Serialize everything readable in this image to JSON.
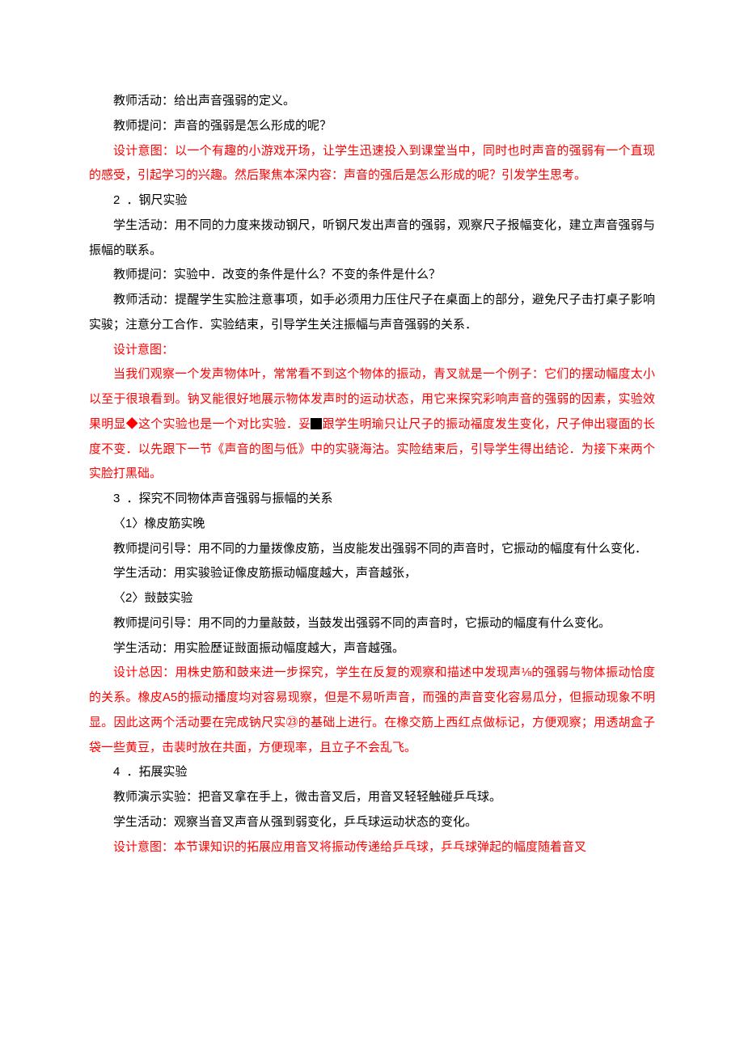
{
  "p1": "教师活动：给出声音强弱的定义。",
  "p2": "教师提问：声音的强弱是怎么形成的呢？",
  "p3": "设计意图：以一个有趣的小游戏开场，让学生迅速投入到课堂当中，同时也时声音的强弱有一个直现的感受，引起学习的兴趣。然后聚焦本深内容：声音的强后是怎么形成的呢？引发学生思考。",
  "s2_num": "2",
  "s2_title": "．钢尺实验",
  "p4": "学生活动：用不同的力度来拨动钢尺，听钢尺发出声音的强弱，观察尺子报幅变化，建立声音强弱与振幅的联系。",
  "p5": "教师提问：实验中．改变的条件是什么？不变的条件是什么？",
  "p6": "教师活动：提醒学生实脸注意事项，如手必须用力压住尺子在桌面上的部分，避免尺子击打桌子影响实骏；注意分工合作．实验结束，引导学生关注振幅与声音强弱的关系．",
  "p7": "设计意图：",
  "p8a": "当我们观察一个发声物体叶，常常看不到这个物体的振动，青叉就是一个例子：它们的摆动幅度太小以至于很琅看到。钠叉能很好地展示物体发声时的运动状态，用它来探究彩响声音的强弱的因素，实验效果明显◆这个实验也是一个对比实验．妥",
  "p8b": "跟学生明瑜只让尺子的振动福度发生变化，尺子伸出寝面的长度不变．以先跟下一节《声音的图与低》中的实骁海沽。实险结束后，引导学生得出结论．为接下来两个实脸打黑础。",
  "s3_num": "3",
  "s3_title": "．探究不同物体声音强弱与振幅的关系",
  "sub1_paren": "〈1〉",
  "sub1_title": "橡皮筋实晚",
  "p9": "教师提问引导：用不同的力量拨像皮筋，当皮能发出强弱不同的声音时，它振动的幅度有什么变化．",
  "p10": "学生活动：用实骏验证像皮筋振动幅度越大，声音越张，",
  "sub2_paren": "〈2〉",
  "sub2_title": "敱鼓实验",
  "p11": "教师提问引导：用不同的力量敲鼓，当鼓发出强弱不同的声音时，它振动的幅度有什么变化。",
  "p12": "学生活动：用实脸歷证敱面振动幅度越大，声音越强。",
  "p13a": "设计总因：用株史筋和鼓来进一步探究，学生在反复的观察和描述中发现声",
  "p13_frac": "⅛",
  "p13b": "的强弱与物体振动恰度的关系。橡皮",
  "p13_a5": "A5",
  "p13c": "的振动播度均对容易现察，但是不易听声音，而强的声音变化容易瓜分，但振动现象不明显。因此这两个活动要在完成钠尺实㉓的基础上进行。在橡交筋上西红点做标记，方便观察；用透胡盒子袋一些黄豆，击裴时放在共面，方便现率，且立子不会乱飞。",
  "s4_num": "4",
  "s4_title": "．拓展实验",
  "p14": "教师演示实验：把音叉拿在手上，微击音叉后，用音叉轻轻触碰乒乓球。",
  "p15": "学生活动：观察当音叉声音从强到弱变化，乒乓球运动状态的变化。",
  "p16": "设计意图：本节课知识的拓展应用音叉将振动传递给乒乓球，乒乓球弹起的幅度随着音叉"
}
